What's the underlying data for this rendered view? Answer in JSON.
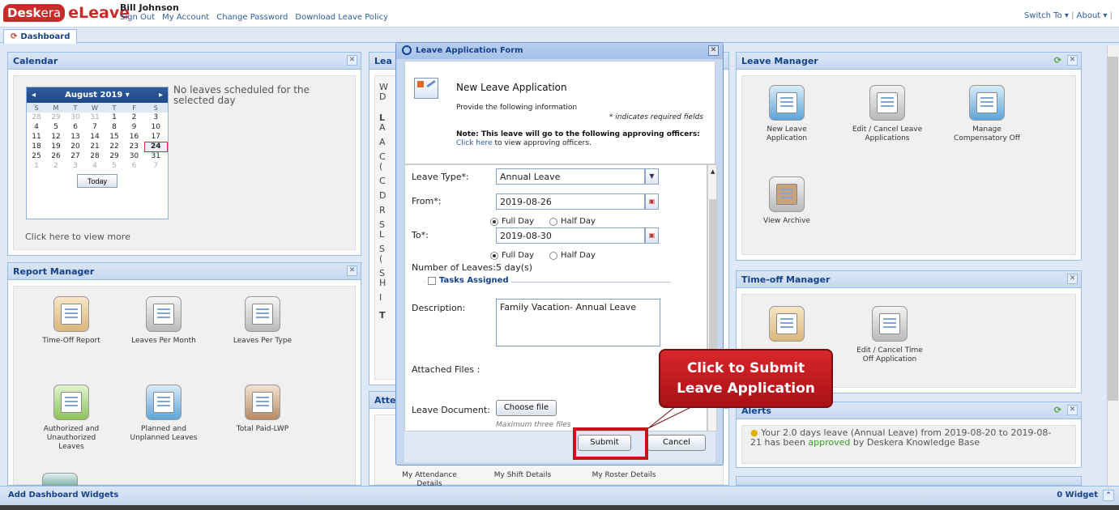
{
  "header": {
    "logo_mark": "Desk",
    "logo_mark2": "era",
    "logo_name": "eLeave",
    "user_name": "Bill Johnson",
    "links": [
      "Sign Out",
      "My Account",
      "Change Password",
      "Download Leave Policy"
    ],
    "switch_to": "Switch To",
    "about": "About"
  },
  "tabs": {
    "dashboard": "Dashboard"
  },
  "calendar_panel": {
    "title": "Calendar",
    "month_label": "August 2019",
    "no_leaves": "No leaves scheduled for the selected day",
    "day_names": [
      "S",
      "M",
      "T",
      "W",
      "T",
      "F",
      "S"
    ],
    "weeks": [
      [
        "28",
        "29",
        "30",
        "31",
        "1",
        "2",
        "3"
      ],
      [
        "4",
        "5",
        "6",
        "7",
        "8",
        "9",
        "10"
      ],
      [
        "11",
        "12",
        "13",
        "14",
        "15",
        "16",
        "17"
      ],
      [
        "18",
        "19",
        "20",
        "21",
        "22",
        "23",
        "24"
      ],
      [
        "25",
        "26",
        "27",
        "28",
        "29",
        "30",
        "31"
      ],
      [
        "1",
        "2",
        "3",
        "4",
        "5",
        "6",
        "7"
      ]
    ],
    "selected_day": "24",
    "today_button": "Today",
    "view_more": "Click here to view more"
  },
  "report_manager": {
    "title": "Report Manager",
    "items": [
      "Time-Off Report",
      "Leaves Per Month",
      "Leaves Per Type",
      "Authorized and Unauthorized Leaves",
      "Planned and Unplanned Leaves",
      "Total Paid-LWP"
    ]
  },
  "middle_panel": {
    "title_partial": "Lea",
    "lines": [
      "W",
      "D",
      "L",
      "A",
      "A",
      "C",
      "(",
      "C",
      "D",
      "R",
      "S",
      "L",
      "S",
      "(",
      "S",
      "H",
      "I",
      "T"
    ],
    "attendance_title": "Atte",
    "items": [
      "My Attendance Details",
      "My Shift Details",
      "My Roster Details"
    ]
  },
  "leave_manager": {
    "title": "Leave Manager",
    "items": [
      "New Leave Application",
      "Edit / Cancel Leave Applications",
      "Manage Compensatory Off",
      "View Archive"
    ]
  },
  "timeoff_manager": {
    "title": "Time-off Manager",
    "items": [
      "Edit / Cancel Time Off Application"
    ]
  },
  "alerts": {
    "title": "Alerts",
    "message_pre": "Your 2.0 days leave (Annual Leave) from 2019-08-20 to 2019-08-21 has been ",
    "message_status": "approved",
    "message_post": " by Deskera Knowledge Base"
  },
  "modal": {
    "title": "Leave Application Form",
    "heading": "New Leave Application",
    "provide": "Provide the following information",
    "required_note": "* indicates required fields",
    "note_bold": "Note: This leave will go to the following approving officers:",
    "click_here": "Click here",
    "click_here_rest": " to view approving officers.",
    "leave_type_label": "Leave Type*:",
    "leave_type_value": "Annual Leave",
    "from_label": "From*:",
    "from_value": "2019-08-26",
    "to_label": "To*:",
    "to_value": "2019-08-30",
    "full_day": "Full Day",
    "half_day": "Half Day",
    "number_label": "Number of Leaves:",
    "number_value": "5 day(s)",
    "tasks_assigned": "Tasks Assigned",
    "description_label": "Description:",
    "description_value": "Family Vacation- Annual Leave",
    "attached_label": "Attached Files :",
    "document_label": "Leave Document:",
    "choose_file": "Choose file",
    "max_files": "Maximum three files",
    "submit": "Submit",
    "cancel": "Cancel"
  },
  "callout": {
    "line1": "Click to Submit",
    "line2": "Leave Application"
  },
  "footer": {
    "add_widgets": "Add Dashboard Widgets",
    "widget_count": "0 Widget"
  },
  "colors": {
    "brand": "#c92b2b",
    "panel_title": "#15428b",
    "callout": "#c0161c",
    "approved": "#3a9a2a"
  }
}
